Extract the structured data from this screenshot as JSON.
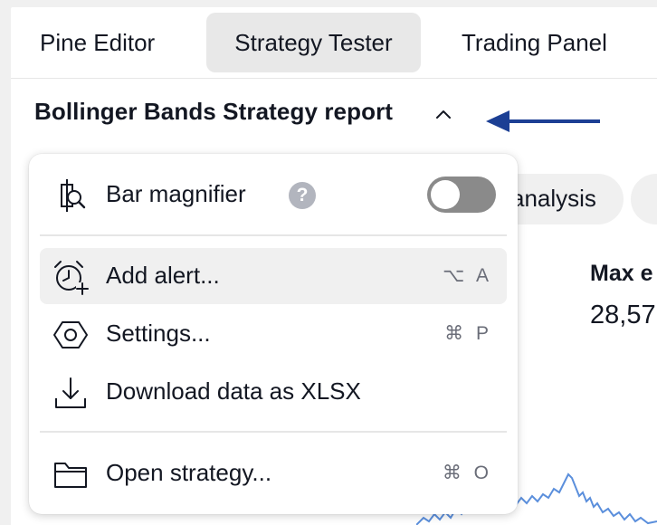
{
  "tabs": [
    {
      "label": "Pine Editor"
    },
    {
      "label": "Strategy Tester",
      "active": true
    },
    {
      "label": "Trading Panel"
    }
  ],
  "report": {
    "title": "Bollinger Bands Strategy report"
  },
  "background": {
    "pill_label": "analysis",
    "pill2_label": "",
    "metric_label": "Max e",
    "metric_value": "28,57"
  },
  "menu": {
    "bar_magnifier": {
      "label": "Bar magnifier",
      "help": "?",
      "toggle_on": false
    },
    "items": [
      {
        "label": "Add alert...",
        "shortcut": "⌥ A",
        "icon": "add-alert-icon"
      },
      {
        "label": "Settings...",
        "shortcut": "⌘ P",
        "icon": "settings-icon"
      },
      {
        "label": "Download data as XLSX",
        "shortcut": "",
        "icon": "download-icon"
      },
      {
        "label": "Open strategy...",
        "shortcut": "⌘ O",
        "icon": "folder-icon"
      }
    ]
  },
  "colors": {
    "annotation_arrow": "#1c3f94",
    "chart_line": "#5b8fdc",
    "toggle_off": "#8a8a8a"
  }
}
